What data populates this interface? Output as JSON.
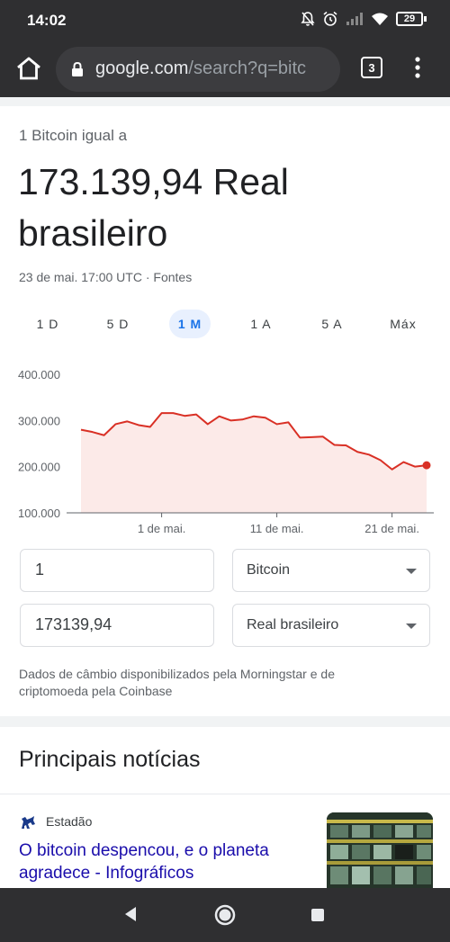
{
  "status_bar": {
    "time": "14:02",
    "battery": "29",
    "icons": [
      "bell-off-icon",
      "alarm-icon",
      "signal-icon",
      "wifi-icon",
      "battery-icon"
    ]
  },
  "browser": {
    "url_domain": "google.com",
    "url_path": "/search?q=bitc",
    "tab_count": "3",
    "icons": [
      "home-icon",
      "lock-icon",
      "tabs-icon",
      "more-vert-icon"
    ]
  },
  "converter": {
    "equal_label": "1 Bitcoin igual a",
    "result": "173.139,94 Real brasileiro",
    "updated": "23 de mai. 17:00 UTC",
    "sources": "Fontes",
    "ranges": [
      "1 D",
      "5 D",
      "1 M",
      "1 A",
      "5 A",
      "Máx"
    ],
    "active_range": "1 M",
    "amount_from": "1",
    "currency_from": "Bitcoin",
    "amount_to": "173139,94",
    "currency_to": "Real brasileiro",
    "disclaimer": "Dados de câmbio disponibilizados pela Morningstar e de criptomoeda pela Coinbase"
  },
  "chart_data": {
    "type": "area",
    "x": [
      0,
      1,
      2,
      3,
      4,
      5,
      6,
      7,
      8,
      9,
      10,
      11,
      12,
      13,
      14,
      15,
      16,
      17,
      18,
      19,
      20,
      21,
      22,
      23,
      24,
      25,
      26,
      27,
      28,
      29,
      30
    ],
    "values": [
      280000,
      275000,
      268000,
      292000,
      298000,
      290000,
      286000,
      316000,
      316000,
      310000,
      313000,
      292000,
      309000,
      300000,
      302000,
      309000,
      306000,
      292000,
      296000,
      263000,
      264000,
      265000,
      247000,
      246000,
      232000,
      226000,
      214000,
      194000,
      210000,
      200000,
      203000
    ],
    "x_ticks": [
      {
        "x": 7,
        "label": "1 de mai."
      },
      {
        "x": 17,
        "label": "11 de mai."
      },
      {
        "x": 27,
        "label": "21 de mai."
      }
    ],
    "y_ticks": [
      400000,
      300000,
      200000,
      100000
    ],
    "y_tick_labels": [
      "400.000",
      "300.000",
      "200.000",
      "100.000"
    ],
    "ylim": [
      100000,
      400000
    ],
    "line_color": "#d93025",
    "fill_color": "#fce8e6",
    "grid": false
  },
  "news": {
    "heading": "Principais notícias",
    "source": "Estadão",
    "title": "O bitcoin despencou, e o planeta agradece - Infográficos"
  },
  "nav": {
    "icons": [
      "back-icon",
      "home-circle-icon",
      "recents-icon"
    ]
  }
}
